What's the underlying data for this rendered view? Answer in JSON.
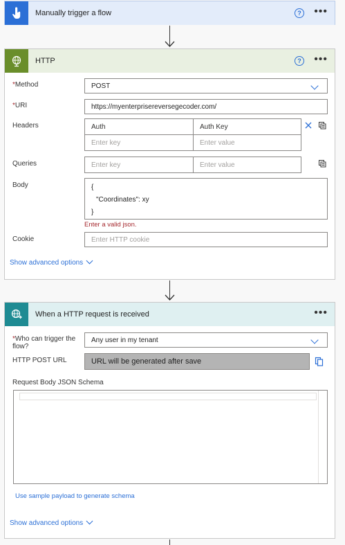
{
  "trigger": {
    "title": "Manually trigger a flow",
    "help": "?",
    "more": "•••"
  },
  "http": {
    "title": "HTTP",
    "help": "?",
    "more": "•••",
    "method_label": "Method",
    "method_value": "POST",
    "uri_label": "URI",
    "uri_value": "https://myenterprisereversegecoder.com/",
    "headers_label": "Headers",
    "headers": [
      {
        "key": "Auth",
        "value": "Auth Key"
      }
    ],
    "key_placeholder": "Enter key",
    "value_placeholder": "Enter value",
    "queries_label": "Queries",
    "body_label": "Body",
    "body_lines": [
      "{",
      "\"Coordinates\": xy",
      "}"
    ],
    "body_error": "Enter a valid json.",
    "cookie_label": "Cookie",
    "cookie_placeholder": "Enter HTTP cookie",
    "advanced": "Show advanced options"
  },
  "request": {
    "title": "When a HTTP request is received",
    "more": "•••",
    "who_label_1": "Who can trigger the",
    "who_label_2": "flow?",
    "who_value": "Any user in my tenant",
    "post_url_label": "HTTP POST URL",
    "post_url_value": "URL will be generated after save",
    "schema_label": "Request Body JSON Schema",
    "sample_link": "Use sample payload to generate schema",
    "advanced": "Show advanced options"
  },
  "colors": {
    "trigger_icon_bg": "#2b6fd6",
    "trigger_header_bg": "#e3ecfa",
    "http_icon_bg": "#6a8e2a",
    "http_header_bg": "#e9f0e1",
    "request_icon_bg": "#1f8b93",
    "request_header_bg": "#dff0f1",
    "link": "#2b6fd6",
    "error": "#a4262c"
  }
}
